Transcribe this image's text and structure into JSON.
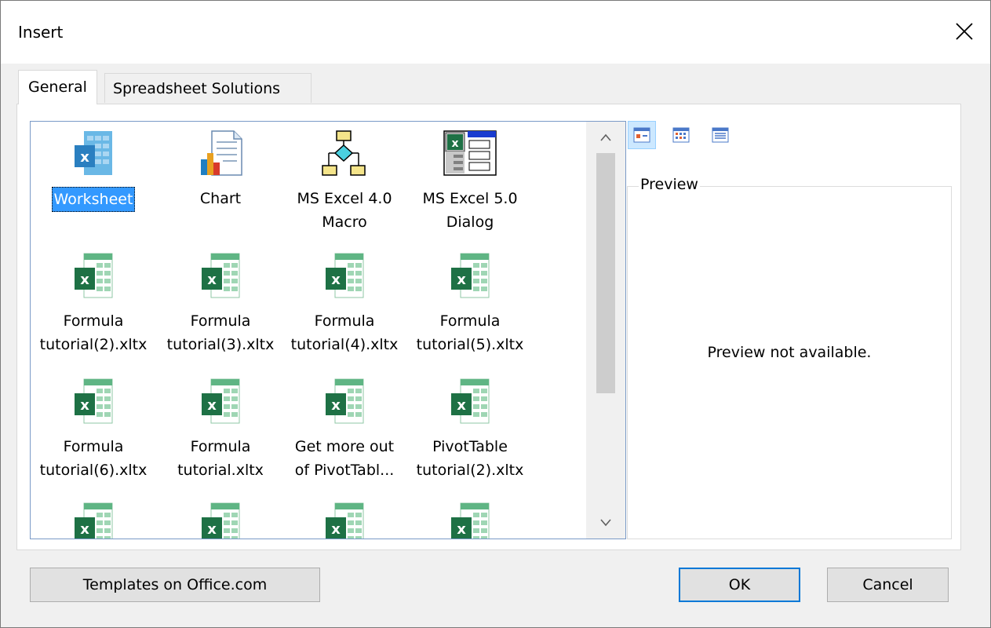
{
  "window": {
    "title": "Insert"
  },
  "tabs": [
    {
      "label": "General",
      "active": true
    },
    {
      "label": "Spreadsheet Solutions",
      "active": false
    }
  ],
  "items": [
    {
      "label": "Worksheet",
      "icon": "worksheet-icon",
      "selected": true
    },
    {
      "label": "Chart",
      "icon": "chart-icon"
    },
    {
      "label": "MS Excel 4.0 Macro",
      "line1": "MS Excel 4.0",
      "line2": "Macro",
      "icon": "macro-flowchart-icon"
    },
    {
      "label": "MS Excel 5.0 Dialog",
      "line1": "MS Excel 5.0",
      "line2": "Dialog",
      "icon": "dialog-icon"
    },
    {
      "line1": "Formula",
      "line2": "tutorial(2).xltx",
      "icon": "excel-template-icon"
    },
    {
      "line1": "Formula",
      "line2": "tutorial(3).xltx",
      "icon": "excel-template-icon"
    },
    {
      "line1": "Formula",
      "line2": "tutorial(4).xltx",
      "icon": "excel-template-icon"
    },
    {
      "line1": "Formula",
      "line2": "tutorial(5).xltx",
      "icon": "excel-template-icon"
    },
    {
      "line1": "Formula",
      "line2": "tutorial(6).xltx",
      "icon": "excel-template-icon"
    },
    {
      "line1": "Formula",
      "line2": "tutorial.xltx",
      "icon": "excel-template-icon"
    },
    {
      "line1": "Get more out",
      "line2": "of PivotTabl...",
      "icon": "excel-template-icon"
    },
    {
      "line1": "PivotTable",
      "line2": "tutorial(2).xltx",
      "icon": "excel-template-icon"
    }
  ],
  "preview": {
    "legend": "Preview",
    "message": "Preview not available."
  },
  "view_buttons": [
    "large-icons-view-icon",
    "list-view-icon",
    "details-view-icon"
  ],
  "buttons": {
    "templates": "Templates on Office.com",
    "ok": "OK",
    "cancel": "Cancel"
  },
  "colors": {
    "selection": "#3399ff",
    "excel_green": "#1e7145",
    "focus_border": "#0078d7"
  }
}
